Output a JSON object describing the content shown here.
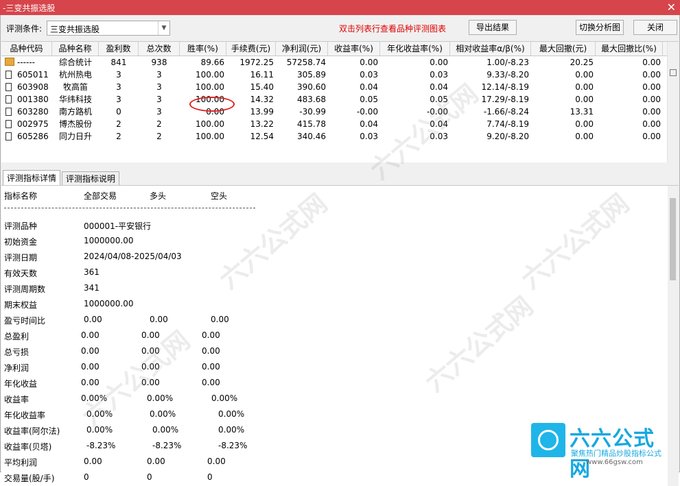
{
  "window": {
    "title": "-三变共振选股",
    "close_glyph": "✕"
  },
  "toolbar": {
    "condition_label": "评测条件:",
    "condition_value": "三变共振选股",
    "hint": "双击列表行查看品种评测图表",
    "export_label": "导出结果",
    "switch_label": "切换分析图",
    "close_label": "关闭"
  },
  "grid": {
    "headers": [
      "品种代码",
      "品种名称",
      "盈利数",
      "总次数",
      "胜率(%)",
      "手续费(元)",
      "净利润(元)",
      "收益率(%)",
      "年化收益率(%)",
      "相对收益率α/β(%)",
      "最大回撤(元)",
      "最大回撤比(%)"
    ],
    "rows": [
      {
        "code": "------",
        "name": "综合统计",
        "win": "841",
        "total": "938",
        "rate": "89.66",
        "fee": "1972.25",
        "profit": "57258.74",
        "ret": "0.00",
        "annual": "0.00",
        "alpha": "1.00/-8.23",
        "dd": "20.25",
        "ddr": "0.00"
      },
      {
        "code": "605011",
        "name": "杭州热电",
        "win": "3",
        "total": "3",
        "rate": "100.00",
        "fee": "16.11",
        "profit": "305.89",
        "ret": "0.03",
        "annual": "0.03",
        "alpha": "9.33/-8.20",
        "dd": "0.00",
        "ddr": "0.00"
      },
      {
        "code": "603908",
        "name": "牧高笛",
        "win": "3",
        "total": "3",
        "rate": "100.00",
        "fee": "15.40",
        "profit": "390.60",
        "ret": "0.04",
        "annual": "0.04",
        "alpha": "12.14/-8.19",
        "dd": "0.00",
        "ddr": "0.00"
      },
      {
        "code": "001380",
        "name": "华纬科技",
        "win": "3",
        "total": "3",
        "rate": "100.00",
        "fee": "14.32",
        "profit": "483.68",
        "ret": "0.05",
        "annual": "0.05",
        "alpha": "17.29/-8.19",
        "dd": "0.00",
        "ddr": "0.00"
      },
      {
        "code": "603280",
        "name": "南方路机",
        "win": "0",
        "total": "3",
        "rate": "0.00",
        "fee": "13.99",
        "profit": "-30.99",
        "ret": "-0.00",
        "annual": "-0.00",
        "alpha": "-1.66/-8.24",
        "dd": "13.31",
        "ddr": "0.00"
      },
      {
        "code": "002975",
        "name": "博杰股份",
        "win": "2",
        "total": "2",
        "rate": "100.00",
        "fee": "13.22",
        "profit": "415.78",
        "ret": "0.04",
        "annual": "0.04",
        "alpha": "7.74/-8.19",
        "dd": "0.00",
        "ddr": "0.00"
      },
      {
        "code": "605286",
        "name": "同力日升",
        "win": "2",
        "total": "2",
        "rate": "100.00",
        "fee": "12.54",
        "profit": "340.46",
        "ret": "0.03",
        "annual": "0.03",
        "alpha": "9.20/-8.20",
        "dd": "0.00",
        "ddr": "0.00"
      }
    ]
  },
  "tabs": [
    "评测指标详情",
    "评测指标说明"
  ],
  "detail": {
    "headers": [
      "指标名称",
      "全部交易",
      "多头",
      "空头"
    ],
    "divider": "------------------------------------------------------------",
    "lines": [
      {
        "label": "评测品种",
        "v1": "000001-平安银行",
        "v2": "",
        "v3": ""
      },
      {
        "label": "初始资金",
        "v1": "1000000.00",
        "v2": "",
        "v3": ""
      },
      {
        "label": "评测日期",
        "v1": "2024/04/08-2025/04/03",
        "v2": "",
        "v3": ""
      },
      {
        "label": "有效天数",
        "v1": "361",
        "v2": "",
        "v3": ""
      },
      {
        "label": "评测周期数",
        "v1": "341",
        "v2": "",
        "v3": ""
      },
      {
        "label": "期末权益",
        "v1": "1000000.00",
        "v2": "",
        "v3": ""
      },
      {
        "label": "盈亏时间比",
        "v1": "0.00",
        "v2": "0.00",
        "v3": "0.00"
      },
      {
        "label": "总盈利",
        "v1": "0.00",
        "v2": "0.00",
        "v3": "0.00"
      },
      {
        "label": "总亏损",
        "v1": "0.00",
        "v2": "0.00",
        "v3": "0.00"
      },
      {
        "label": "净利润",
        "v1": "0.00",
        "v2": "0.00",
        "v3": "0.00"
      },
      {
        "label": "年化收益",
        "v1": "0.00",
        "v2": "0.00",
        "v3": "0.00"
      },
      {
        "label": "收益率",
        "v1": "0.00%",
        "v2": "0.00%",
        "v3": "0.00%"
      },
      {
        "label": "年化收益率",
        "v1": "0.00%",
        "v2": "0.00%",
        "v3": "0.00%"
      },
      {
        "label": "收益率(阿尔法)",
        "v1": "0.00%",
        "v2": "0.00%",
        "v3": "0.00%"
      },
      {
        "label": "收益率(贝塔)",
        "v1": "-8.23%",
        "v2": "-8.23%",
        "v3": "-8.23%"
      },
      {
        "label": "平均利润",
        "v1": "0.00",
        "v2": "0.00",
        "v3": "0.00"
      },
      {
        "label": "交易量(股/手)",
        "v1": "0",
        "v2": "0",
        "v3": "0"
      }
    ]
  },
  "watermark": {
    "text": "六六公式网",
    "brand": "六六公式网",
    "sub": "聚焦热门精品炒股指标公式",
    "url": "www.66gsw.com"
  }
}
